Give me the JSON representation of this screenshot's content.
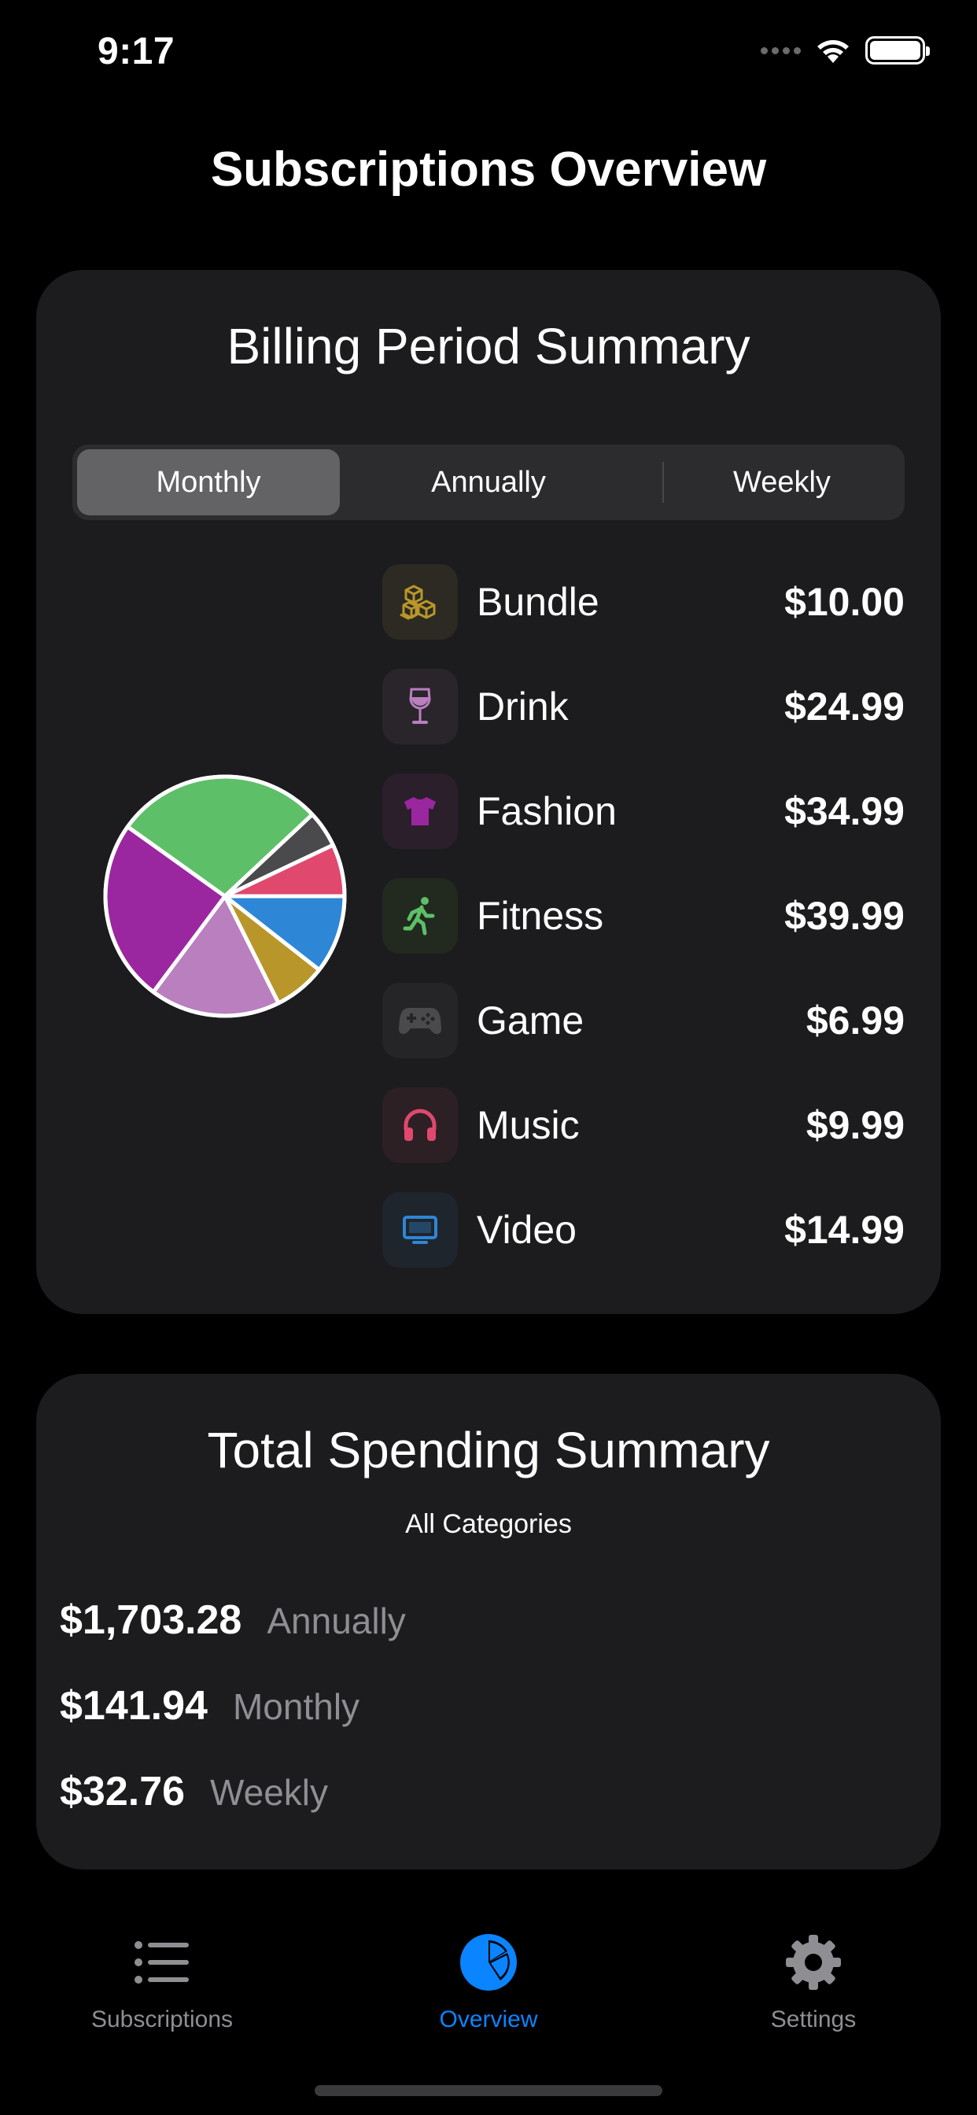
{
  "status_bar": {
    "time": "9:17"
  },
  "page_title": "Subscriptions Overview",
  "billing_card": {
    "title": "Billing Period Summary",
    "segments": [
      "Monthly",
      "Annually",
      "Weekly"
    ],
    "selected_segment": "Monthly",
    "categories": [
      {
        "name": "Bundle",
        "price": "$10.00",
        "icon": "shipping-boxes-icon",
        "color": "#b8962a"
      },
      {
        "name": "Drink",
        "price": "$24.99",
        "icon": "wine-glass-icon",
        "color": "#b97fbf"
      },
      {
        "name": "Fashion",
        "price": "$34.99",
        "icon": "tshirt-icon",
        "color": "#9b27a0"
      },
      {
        "name": "Fitness",
        "price": "$39.99",
        "icon": "running-figure-icon",
        "color": "#5dbf68"
      },
      {
        "name": "Game",
        "price": "$6.99",
        "icon": "gamecontroller-icon",
        "color": "#4a4a4c"
      },
      {
        "name": "Music",
        "price": "$9.99",
        "icon": "headphones-icon",
        "color": "#e0486e"
      },
      {
        "name": "Video",
        "price": "$14.99",
        "icon": "monitor-icon",
        "color": "#2e86d6"
      }
    ]
  },
  "chart_data": {
    "type": "pie",
    "categories": [
      "Video",
      "Bundle",
      "Drink",
      "Fashion",
      "Fitness",
      "Game",
      "Music"
    ],
    "values": [
      14.99,
      10.0,
      24.99,
      34.99,
      39.99,
      6.99,
      9.99
    ],
    "colors": [
      "#2e86d6",
      "#b8962a",
      "#b97fbf",
      "#9b27a0",
      "#5dbf68",
      "#4a4a4c",
      "#e0486e"
    ]
  },
  "total_card": {
    "title": "Total Spending Summary",
    "subtitle": "All Categories",
    "rows": [
      {
        "amount": "$1,703.28",
        "period": "Annually"
      },
      {
        "amount": "$141.94",
        "period": "Monthly"
      },
      {
        "amount": "$32.76",
        "period": "Weekly"
      }
    ]
  },
  "tab_bar": {
    "tabs": [
      {
        "label": "Subscriptions",
        "icon": "list-icon"
      },
      {
        "label": "Overview",
        "icon": "pie-chart-icon"
      },
      {
        "label": "Settings",
        "icon": "gear-icon"
      }
    ],
    "active": "Overview"
  },
  "colors": {
    "accent": "#0a84ff",
    "card_bg": "#1c1c1e",
    "background": "#000000",
    "secondary_text": "#8e8e93"
  }
}
